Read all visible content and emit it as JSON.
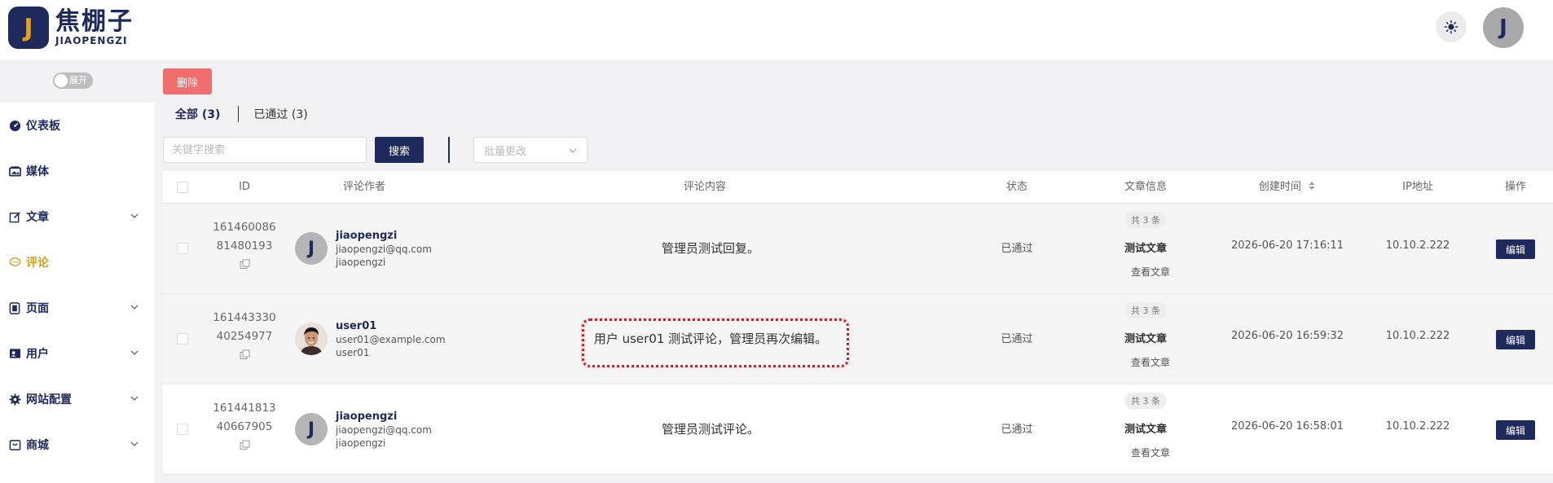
{
  "brand": {
    "mark": "J",
    "name_cn": "焦棚子",
    "name_en": "JIAOPENGZI"
  },
  "header": {
    "user_initial": "J"
  },
  "sidebar": {
    "toggle_label": "展开",
    "items": [
      {
        "label": "仪表板",
        "icon": "dashboard-icon"
      },
      {
        "label": "媒体",
        "icon": "media-icon"
      },
      {
        "label": "文章",
        "icon": "edit-icon"
      },
      {
        "label": "评论",
        "icon": "comment-icon"
      },
      {
        "label": "页面",
        "icon": "page-icon"
      },
      {
        "label": "用户",
        "icon": "user-card-icon"
      },
      {
        "label": "网站配置",
        "icon": "gear-icon"
      },
      {
        "label": "商城",
        "icon": "shop-icon"
      }
    ]
  },
  "toolbar": {
    "delete_label": "删除",
    "search_placeholder": "关键字搜索",
    "search_label": "搜索",
    "bulk_placeholder": "批量更改"
  },
  "tabs": [
    {
      "label": "全部 (3)"
    },
    {
      "label": "已通过 (3)"
    }
  ],
  "table": {
    "headers": [
      "ID",
      "评论作者",
      "评论内容",
      "状态",
      "文章信息",
      "创建时间",
      "IP地址",
      "操作"
    ],
    "rows": [
      {
        "id_line1": "161460086",
        "id_line2": "81480193",
        "avatar_initial": "J",
        "author_name": "jiaopengzi",
        "author_email": "jiaopengzi@qq.com",
        "author_login": "jiaopengzi",
        "content": "管理员测试回复。",
        "status": "已通过",
        "count_badge": "共 3 条",
        "article_title": "测试文章",
        "article_link": "查看文章",
        "created": "2026-06-20 17:16:11",
        "ip": "10.10.2.222",
        "action": "编辑"
      },
      {
        "id_line1": "161443330",
        "id_line2": "40254977",
        "avatar_initial": "",
        "author_name": "user01",
        "author_email": "user01@example.com",
        "author_login": "user01",
        "content": "用户 user01 测试评论，管理员再次编辑。",
        "status": "已通过",
        "count_badge": "共 3 条",
        "article_title": "测试文章",
        "article_link": "查看文章",
        "created": "2026-06-20 16:59:32",
        "ip": "10.10.2.222",
        "action": "编辑"
      },
      {
        "id_line1": "161441813",
        "id_line2": "40667905",
        "avatar_initial": "J",
        "author_name": "jiaopengzi",
        "author_email": "jiaopengzi@qq.com",
        "author_login": "jiaopengzi",
        "content": "管理员测试评论。",
        "status": "已通过",
        "count_badge": "共 3 条",
        "article_title": "测试文章",
        "article_link": "查看文章",
        "created": "2026-06-20 16:58:01",
        "ip": "10.10.2.222",
        "action": "编辑"
      }
    ]
  },
  "colors": {
    "brand": "#1e2a5c",
    "accent": "#d4a017",
    "danger": "#f26d6d",
    "highlight": "#d21f1f"
  }
}
